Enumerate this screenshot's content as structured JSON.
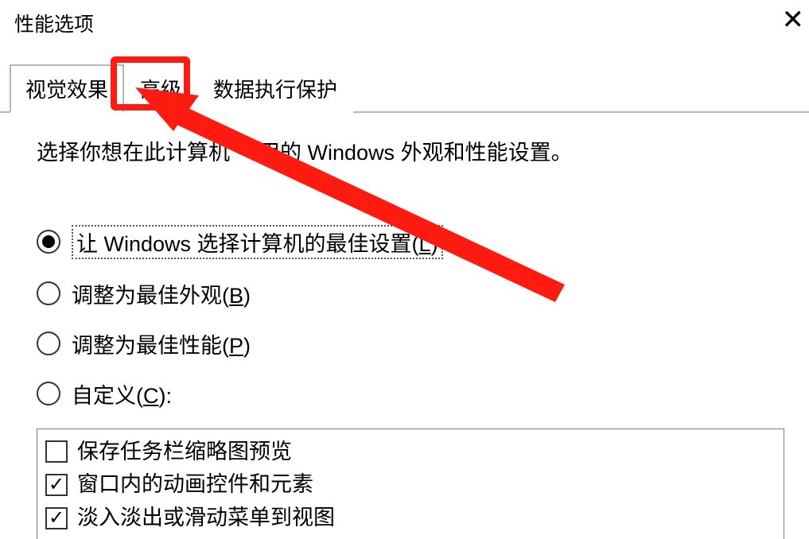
{
  "window": {
    "title": "性能选项",
    "close_symbol": "✕"
  },
  "tabs": {
    "items": [
      {
        "label": "视觉效果",
        "active": true
      },
      {
        "label": "高级",
        "active": false,
        "highlighted": true
      },
      {
        "label": "数据执行保护",
        "active": false
      }
    ]
  },
  "intro": {
    "prefix": "选择你想在此计算机",
    "obscured_gap": "    ",
    "suffix": "用的 Windows 外观和性能设置。"
  },
  "radios": {
    "items": [
      {
        "label_prefix": "让 Windows 选择计算机的最佳设置(",
        "hotkey": "L",
        "label_suffix": ")",
        "checked": true,
        "focused": true
      },
      {
        "label_prefix": "调整为最佳外观(",
        "hotkey": "B",
        "label_suffix": ")",
        "checked": false,
        "focused": false
      },
      {
        "label_prefix": "调整为最佳性能(",
        "hotkey": "P",
        "label_suffix": ")",
        "checked": false,
        "focused": false
      },
      {
        "label_prefix": "自定义(",
        "hotkey": "C",
        "label_suffix": "):",
        "checked": false,
        "focused": false
      }
    ]
  },
  "checklist": {
    "items": [
      {
        "label": "保存任务栏缩略图预览",
        "checked": false
      },
      {
        "label": "窗口内的动画控件和元素",
        "checked": true
      },
      {
        "label": "淡入淡出或滑动菜单到视图",
        "checked": true
      }
    ]
  },
  "annotation": {
    "highlight_color": "#ff1b0f"
  }
}
